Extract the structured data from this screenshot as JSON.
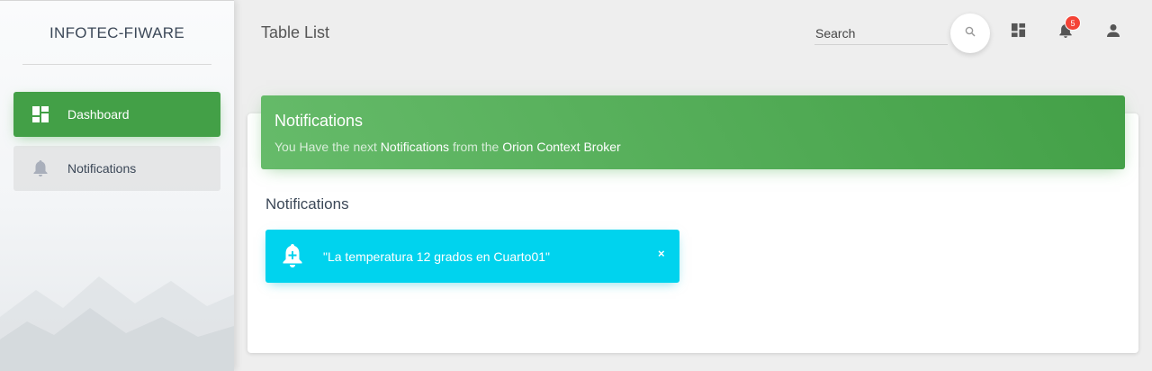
{
  "sidebar": {
    "brand": "INFOTEC-FIWARE",
    "items": [
      {
        "label": "Dashboard",
        "icon": "dashboard-icon",
        "active": true
      },
      {
        "label": "Notifications",
        "icon": "bell-icon",
        "active": false
      }
    ]
  },
  "header": {
    "title": "Table List",
    "search": {
      "placeholder": "Search",
      "value": ""
    },
    "notification_count": "5",
    "icons": [
      "search-icon",
      "dashboard-icon",
      "bell-icon",
      "person-icon"
    ]
  },
  "card": {
    "title": "Notifications",
    "subtitle_prefix": "You Have the next ",
    "subtitle_bold1": "Notifications",
    "subtitle_mid": " from the ",
    "subtitle_bold2": "Orion Context Broker",
    "section_title": "Notifications"
  },
  "alerts": [
    {
      "message": "\"La temperatura 12 grados en Cuarto01\"",
      "close": "×",
      "icon": "bell-plus-icon"
    }
  ],
  "colors": {
    "primary_green": "#43a047",
    "alert_cyan": "#00d3ee",
    "badge_red": "#f44336"
  }
}
